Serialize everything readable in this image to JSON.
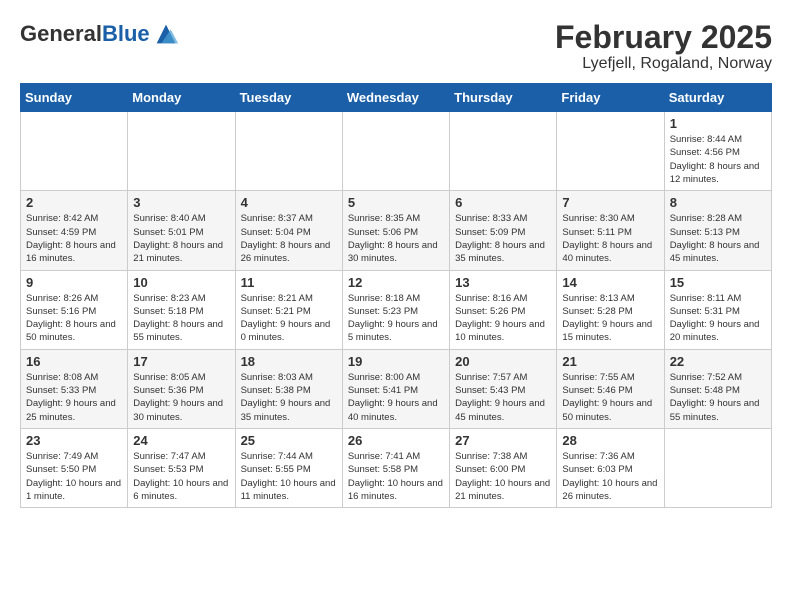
{
  "header": {
    "logo_general": "General",
    "logo_blue": "Blue",
    "month_title": "February 2025",
    "location": "Lyefjell, Rogaland, Norway"
  },
  "weekdays": [
    "Sunday",
    "Monday",
    "Tuesday",
    "Wednesday",
    "Thursday",
    "Friday",
    "Saturday"
  ],
  "weeks": [
    [
      {
        "day": "",
        "info": ""
      },
      {
        "day": "",
        "info": ""
      },
      {
        "day": "",
        "info": ""
      },
      {
        "day": "",
        "info": ""
      },
      {
        "day": "",
        "info": ""
      },
      {
        "day": "",
        "info": ""
      },
      {
        "day": "1",
        "info": "Sunrise: 8:44 AM\nSunset: 4:56 PM\nDaylight: 8 hours and 12 minutes."
      }
    ],
    [
      {
        "day": "2",
        "info": "Sunrise: 8:42 AM\nSunset: 4:59 PM\nDaylight: 8 hours and 16 minutes."
      },
      {
        "day": "3",
        "info": "Sunrise: 8:40 AM\nSunset: 5:01 PM\nDaylight: 8 hours and 21 minutes."
      },
      {
        "day": "4",
        "info": "Sunrise: 8:37 AM\nSunset: 5:04 PM\nDaylight: 8 hours and 26 minutes."
      },
      {
        "day": "5",
        "info": "Sunrise: 8:35 AM\nSunset: 5:06 PM\nDaylight: 8 hours and 30 minutes."
      },
      {
        "day": "6",
        "info": "Sunrise: 8:33 AM\nSunset: 5:09 PM\nDaylight: 8 hours and 35 minutes."
      },
      {
        "day": "7",
        "info": "Sunrise: 8:30 AM\nSunset: 5:11 PM\nDaylight: 8 hours and 40 minutes."
      },
      {
        "day": "8",
        "info": "Sunrise: 8:28 AM\nSunset: 5:13 PM\nDaylight: 8 hours and 45 minutes."
      }
    ],
    [
      {
        "day": "9",
        "info": "Sunrise: 8:26 AM\nSunset: 5:16 PM\nDaylight: 8 hours and 50 minutes."
      },
      {
        "day": "10",
        "info": "Sunrise: 8:23 AM\nSunset: 5:18 PM\nDaylight: 8 hours and 55 minutes."
      },
      {
        "day": "11",
        "info": "Sunrise: 8:21 AM\nSunset: 5:21 PM\nDaylight: 9 hours and 0 minutes."
      },
      {
        "day": "12",
        "info": "Sunrise: 8:18 AM\nSunset: 5:23 PM\nDaylight: 9 hours and 5 minutes."
      },
      {
        "day": "13",
        "info": "Sunrise: 8:16 AM\nSunset: 5:26 PM\nDaylight: 9 hours and 10 minutes."
      },
      {
        "day": "14",
        "info": "Sunrise: 8:13 AM\nSunset: 5:28 PM\nDaylight: 9 hours and 15 minutes."
      },
      {
        "day": "15",
        "info": "Sunrise: 8:11 AM\nSunset: 5:31 PM\nDaylight: 9 hours and 20 minutes."
      }
    ],
    [
      {
        "day": "16",
        "info": "Sunrise: 8:08 AM\nSunset: 5:33 PM\nDaylight: 9 hours and 25 minutes."
      },
      {
        "day": "17",
        "info": "Sunrise: 8:05 AM\nSunset: 5:36 PM\nDaylight: 9 hours and 30 minutes."
      },
      {
        "day": "18",
        "info": "Sunrise: 8:03 AM\nSunset: 5:38 PM\nDaylight: 9 hours and 35 minutes."
      },
      {
        "day": "19",
        "info": "Sunrise: 8:00 AM\nSunset: 5:41 PM\nDaylight: 9 hours and 40 minutes."
      },
      {
        "day": "20",
        "info": "Sunrise: 7:57 AM\nSunset: 5:43 PM\nDaylight: 9 hours and 45 minutes."
      },
      {
        "day": "21",
        "info": "Sunrise: 7:55 AM\nSunset: 5:46 PM\nDaylight: 9 hours and 50 minutes."
      },
      {
        "day": "22",
        "info": "Sunrise: 7:52 AM\nSunset: 5:48 PM\nDaylight: 9 hours and 55 minutes."
      }
    ],
    [
      {
        "day": "23",
        "info": "Sunrise: 7:49 AM\nSunset: 5:50 PM\nDaylight: 10 hours and 1 minute."
      },
      {
        "day": "24",
        "info": "Sunrise: 7:47 AM\nSunset: 5:53 PM\nDaylight: 10 hours and 6 minutes."
      },
      {
        "day": "25",
        "info": "Sunrise: 7:44 AM\nSunset: 5:55 PM\nDaylight: 10 hours and 11 minutes."
      },
      {
        "day": "26",
        "info": "Sunrise: 7:41 AM\nSunset: 5:58 PM\nDaylight: 10 hours and 16 minutes."
      },
      {
        "day": "27",
        "info": "Sunrise: 7:38 AM\nSunset: 6:00 PM\nDaylight: 10 hours and 21 minutes."
      },
      {
        "day": "28",
        "info": "Sunrise: 7:36 AM\nSunset: 6:03 PM\nDaylight: 10 hours and 26 minutes."
      },
      {
        "day": "",
        "info": ""
      }
    ]
  ]
}
